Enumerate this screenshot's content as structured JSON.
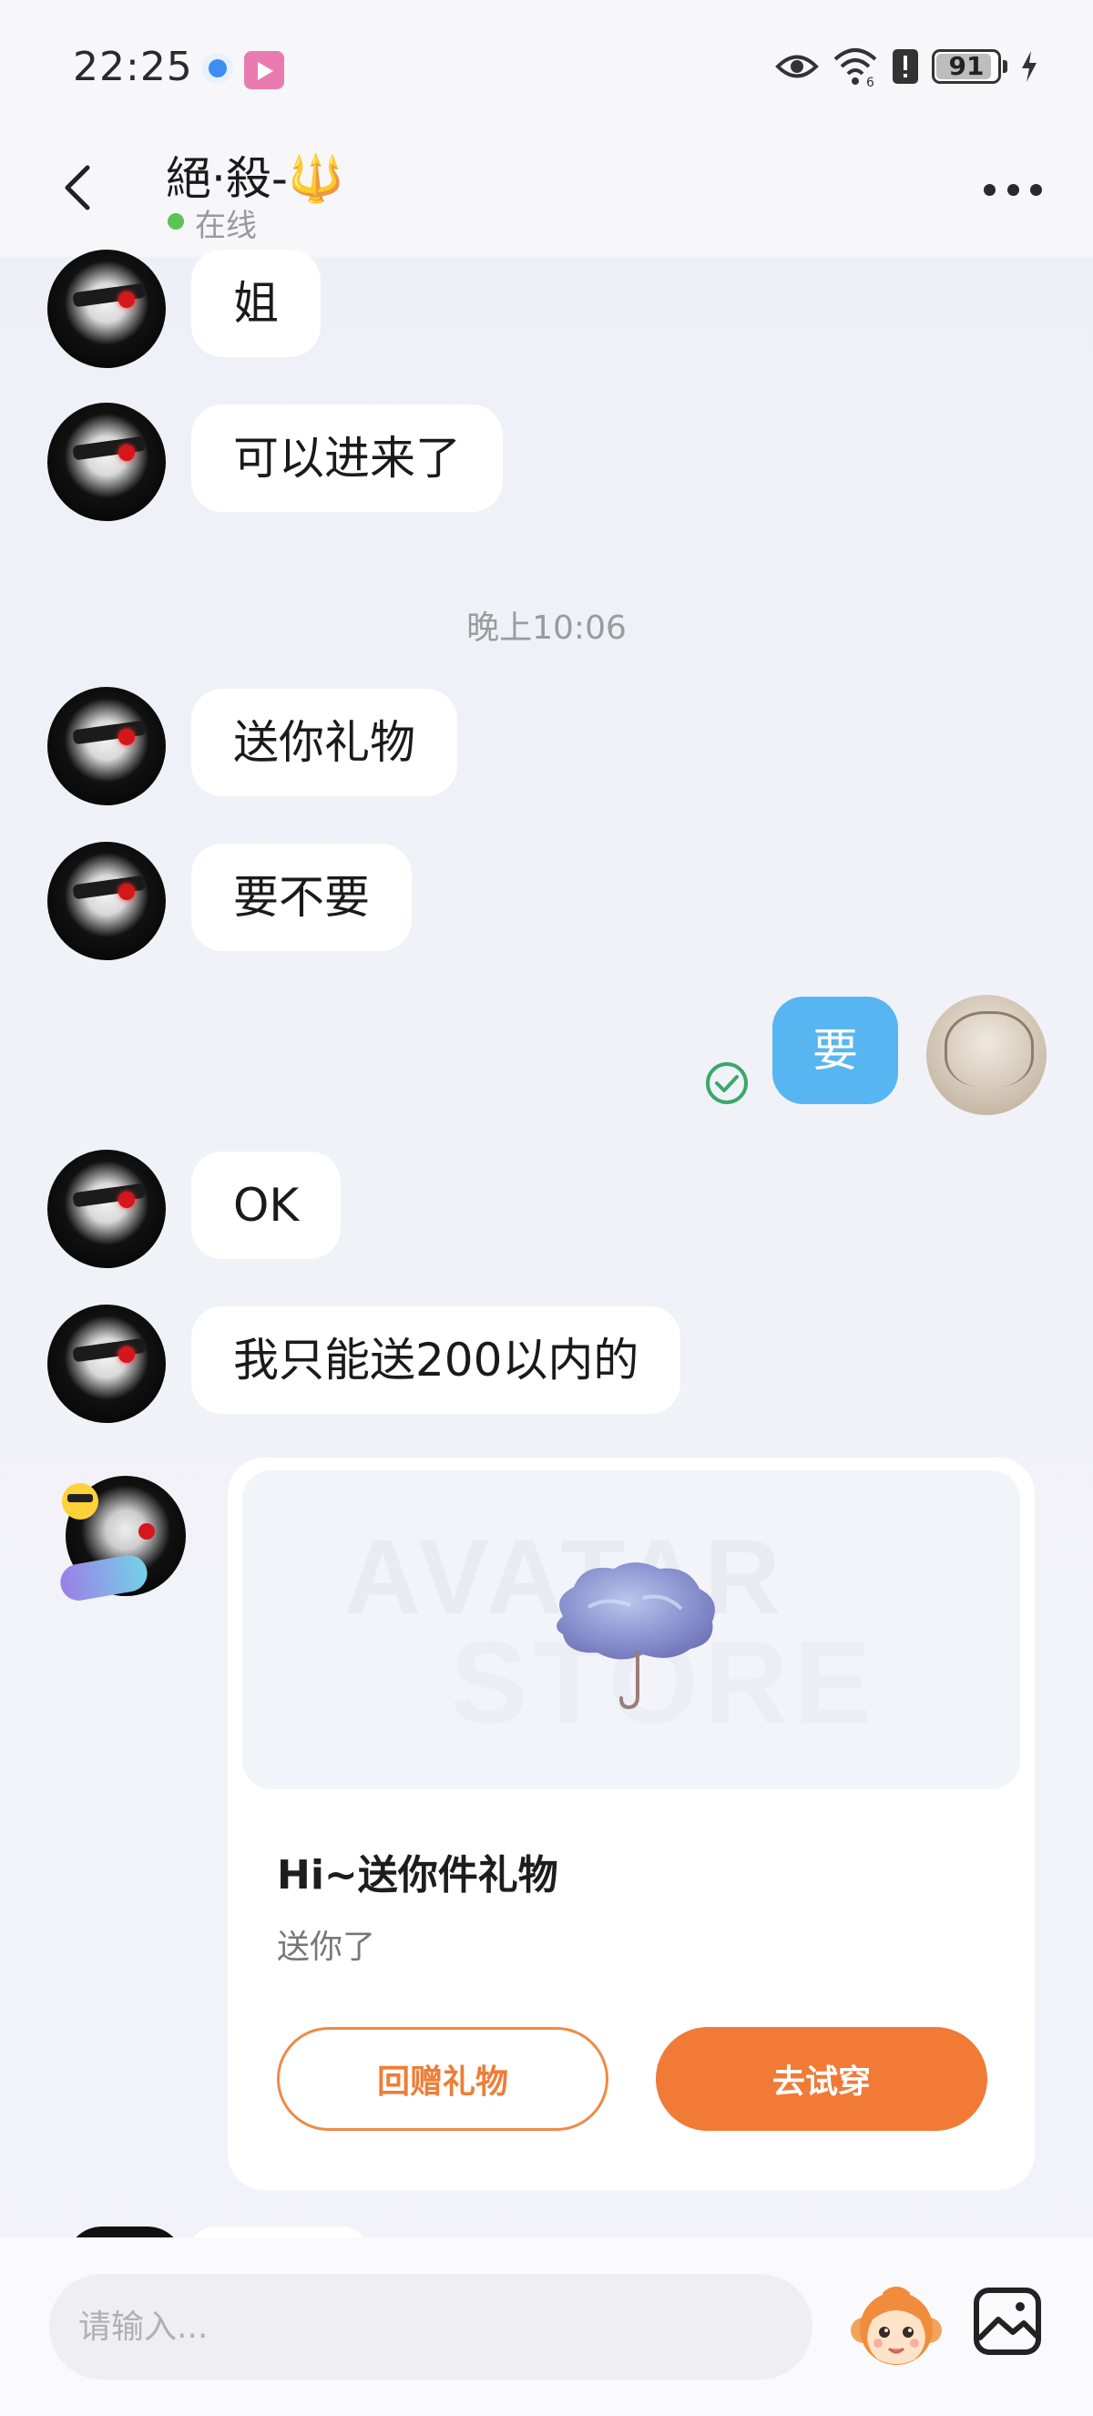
{
  "status_bar": {
    "time": "22:25",
    "battery": "91"
  },
  "header": {
    "title": "絕·殺-🔱",
    "status": "在线"
  },
  "messages": [
    {
      "side": "left",
      "text": "姐"
    },
    {
      "side": "left",
      "text": "可以进来了"
    },
    {
      "type": "time",
      "text": "晚上10:06"
    },
    {
      "side": "left",
      "text": "送你礼物"
    },
    {
      "side": "left",
      "text": "要不要"
    },
    {
      "side": "right",
      "text": "要"
    },
    {
      "side": "left",
      "text": "OK"
    },
    {
      "side": "left",
      "text": "我只能送200以内的"
    }
  ],
  "gift_card": {
    "watermark_line1": "AVATAR",
    "watermark_line2": "STORE",
    "title": "Hi~送你件礼物",
    "subtitle": "送你了",
    "return_gift_label": "回赠礼物",
    "try_on_label": "去试穿",
    "accent": "#F07A36"
  },
  "input": {
    "placeholder": "请输入..."
  },
  "colors": {
    "my_bubble": "#57B6F2",
    "online": "#5BC454"
  }
}
